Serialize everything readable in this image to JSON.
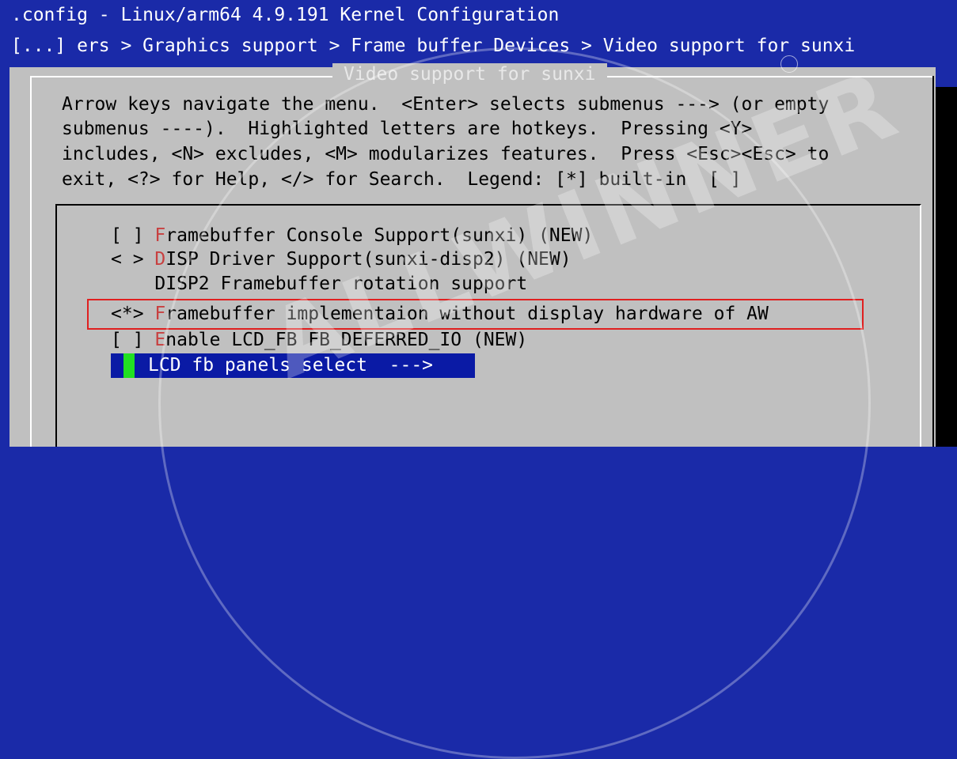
{
  "window": {
    "title": ".config - Linux/arm64 4.9.191 Kernel Configuration",
    "breadcrumb": "[...] ers > Graphics support > Frame buffer Devices > Video support for sunxi"
  },
  "dialog": {
    "title": "Video support for sunxi",
    "help_lines": [
      "Arrow keys navigate the menu.  <Enter> selects submenus ---> (or empty",
      "submenus ----).  Highlighted letters are hotkeys.  Pressing <Y>",
      "includes, <N> excludes, <M> modularizes features.  Press <Esc><Esc> to",
      "exit, <?> for Help, </> for Search.  Legend: [*] built-in  [ ]"
    ]
  },
  "menu": {
    "items": [
      {
        "marker": "[ ] ",
        "hotkey": "F",
        "rest": "ramebuffer Console Support(sunxi) (NEW)"
      },
      {
        "marker": "< > ",
        "hotkey": "D",
        "rest": "ISP Driver Support(sunxi-disp2) (NEW)"
      },
      {
        "marker": "    ",
        "hotkey": "",
        "rest": "DISP2 Framebuffer rotation support"
      },
      {
        "marker": "<*> ",
        "hotkey": "F",
        "rest": "ramebuffer implementaion without display hardware of AW"
      },
      {
        "marker": "[ ] ",
        "hotkey": "E",
        "rest": "nable LCD_FB FB_DEFERRED_IO (NEW)"
      }
    ],
    "selected": {
      "label": "LCD fb panels select  --->"
    }
  },
  "watermark": {
    "text": "ALLWINNER"
  },
  "colors": {
    "background": "#1a2aa8",
    "dialog": "#c0c0c0",
    "hotkey": "#c84040",
    "highlight_box": "#e02020",
    "cursor": "#22e022",
    "selection": "#0a1aa5"
  }
}
